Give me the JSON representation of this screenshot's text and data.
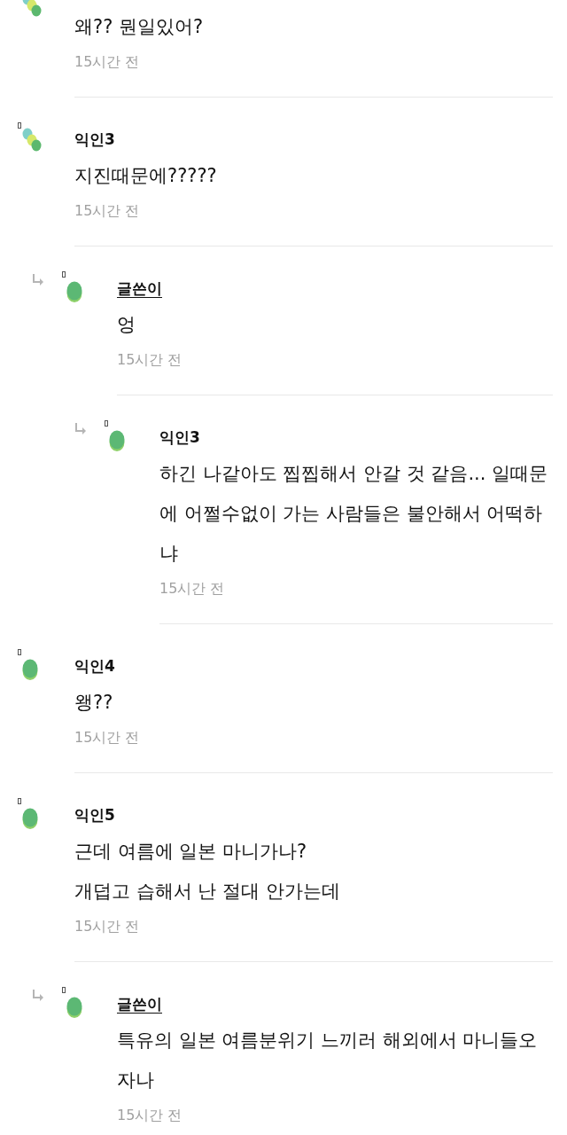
{
  "comments": [
    {
      "kind": "multi",
      "body": "왜?? 뭔일있어?",
      "time": "15시간 전"
    },
    {
      "name": "익인3",
      "author": false,
      "kind": "multi",
      "body": "지진때문에?????",
      "time": "15시간 전",
      "children": [
        {
          "name": "글쓴이",
          "author": true,
          "kind": "single",
          "body": "엉",
          "time": "15시간 전",
          "children": [
            {
              "name": "익인3",
              "author": false,
              "kind": "single",
              "body": "하긴 나같아도 찝찝해서 안갈 것 같음... 일때문에 어쩔수없이 가는 사람들은 불안해서 어떡하냐",
              "time": "15시간 전"
            }
          ]
        }
      ]
    },
    {
      "name": "익인4",
      "author": false,
      "kind": "single",
      "body": "왱??",
      "time": "15시간 전"
    },
    {
      "name": "익인5",
      "author": false,
      "kind": "single",
      "body": "근데 여름에 일본 마니가나?\n개덥고 습해서 난 절대 안가는데",
      "time": "15시간 전",
      "children": [
        {
          "name": "글쓴이",
          "author": true,
          "kind": "single",
          "body": "특유의 일본 여름분위기 느끼러 해외에서 마니들오자나",
          "time": "15시간 전"
        }
      ]
    }
  ]
}
